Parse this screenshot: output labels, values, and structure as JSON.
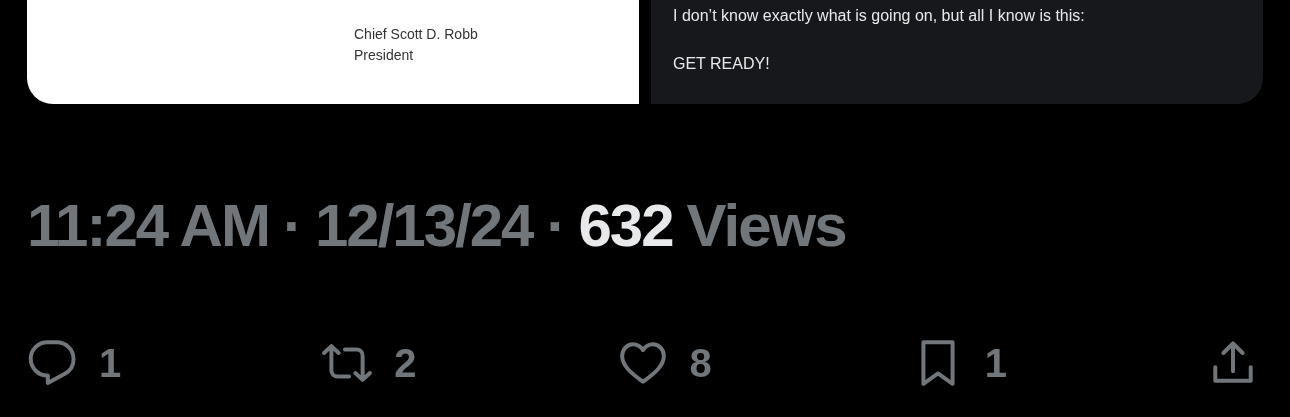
{
  "media": [
    {
      "kind": "document",
      "lines": [
        "Chief Scott D. Robb",
        "President"
      ]
    },
    {
      "kind": "post_screenshot",
      "lines": [
        "I don’t know exactly what is going on, but all I know is this:",
        "GET READY!"
      ]
    }
  ],
  "meta": [
    {
      "text": "11:24 AM",
      "emphasis": false
    },
    {
      "text": "·",
      "emphasis": false
    },
    {
      "text": "12/13/24",
      "emphasis": false
    },
    {
      "text": "·",
      "emphasis": false
    },
    {
      "text": "632",
      "emphasis": true
    },
    {
      "text": "Views",
      "emphasis": false
    }
  ],
  "actions": [
    {
      "kind": "reply",
      "count": "1"
    },
    {
      "kind": "repost",
      "count": "2"
    },
    {
      "kind": "like",
      "count": "8"
    },
    {
      "kind": "bookmark",
      "count": "1"
    },
    {
      "kind": "share"
    }
  ]
}
